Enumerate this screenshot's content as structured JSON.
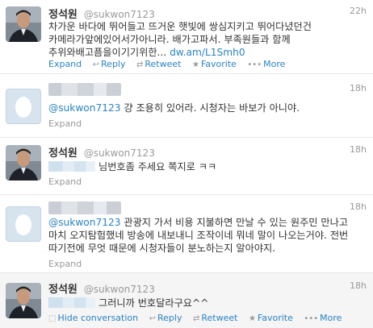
{
  "colors": {
    "link": "#2a83c5",
    "muted": "#999999",
    "text": "#333333",
    "border": "#e8e8e8"
  },
  "tweets": [
    {
      "fullname": "정석원",
      "screenname": "@sukwon7123",
      "time": "22h",
      "text": "차가운 바다에 뛰어들고 뜨거운 햇빛에 쌍심지키고 뛰어다녔던건 카메라가앞에있어서가아니라. 배가고파서. 부족원들과 함께 추위와배고픔을이기기위한...",
      "link": "dw.am/L1Smh0",
      "actions": [
        "Expand",
        "Reply",
        "Retweet",
        "Favorite",
        "More"
      ]
    },
    {
      "mention": "@sukwon7123",
      "text": "걍 조용히 있어라. 시청자는 바보가 아니야.",
      "time": "18h",
      "expand": "Expand"
    },
    {
      "fullname": "정석원",
      "screenname": "@sukwon7123",
      "time": "18h",
      "text": "님번호좀 주세요 쪽지로 ㅋㅋ",
      "expand": "Expand"
    },
    {
      "mention": "@sukwon7123",
      "text": "관광지 가서 비용 지불하면 만날 수 있는 원주민 만나고 마치 오지탐험했네 방송에 내보내니 조작이네 뭐네 말이 나오는거야. 전번 따기전에 무엇 때문에 시청자들이 분노하는지 알아야지.",
      "time": "18h",
      "expand": "Expand"
    },
    {
      "fullname": "정석원",
      "screenname": "@sukwon7123",
      "time": "18h",
      "text": "그러니까 번호달라구요^^",
      "actions": [
        "Hide conversation",
        "Reply",
        "Retweet",
        "Favorite",
        "More"
      ]
    }
  ]
}
